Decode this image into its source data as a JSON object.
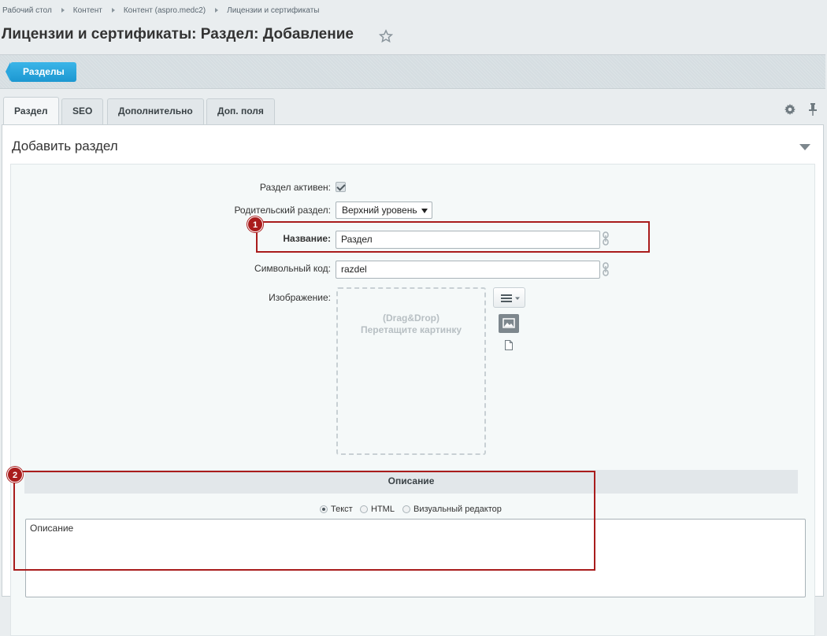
{
  "breadcrumb": [
    "Рабочий стол",
    "Контент",
    "Контент (aspro.medc2)",
    "Лицензии и сертификаты"
  ],
  "page_title": "Лицензии и сертификаты: Раздел: Добавление",
  "toolbar": {
    "back_label": "Разделы"
  },
  "tabs": [
    {
      "label": "Раздел",
      "active": true
    },
    {
      "label": "SEO",
      "active": false
    },
    {
      "label": "Дополнительно",
      "active": false
    },
    {
      "label": "Доп. поля",
      "active": false
    }
  ],
  "panel": {
    "title": "Добавить раздел"
  },
  "form": {
    "active_label": "Раздел активен:",
    "active_checked": true,
    "parent_label": "Родительский раздел:",
    "parent_value": "Верхний уровень",
    "name_label": "Название:",
    "name_value": "Раздел",
    "code_label": "Символьный код:",
    "code_value": "razdel",
    "image_label": "Изображение:",
    "dropzone_line1": "(Drag&Drop)",
    "dropzone_line2": "Перетащите картинку"
  },
  "description": {
    "header": "Описание",
    "modes": [
      {
        "label": "Текст",
        "checked": true
      },
      {
        "label": "HTML",
        "checked": false
      },
      {
        "label": "Визуальный редактор",
        "checked": false
      }
    ],
    "value": "Описание"
  },
  "annotations": [
    {
      "number": "1"
    },
    {
      "number": "2"
    }
  ],
  "colors": {
    "annotation": "#a91c1c",
    "accent_button": "#1c97d1",
    "background": "#e9edef"
  }
}
